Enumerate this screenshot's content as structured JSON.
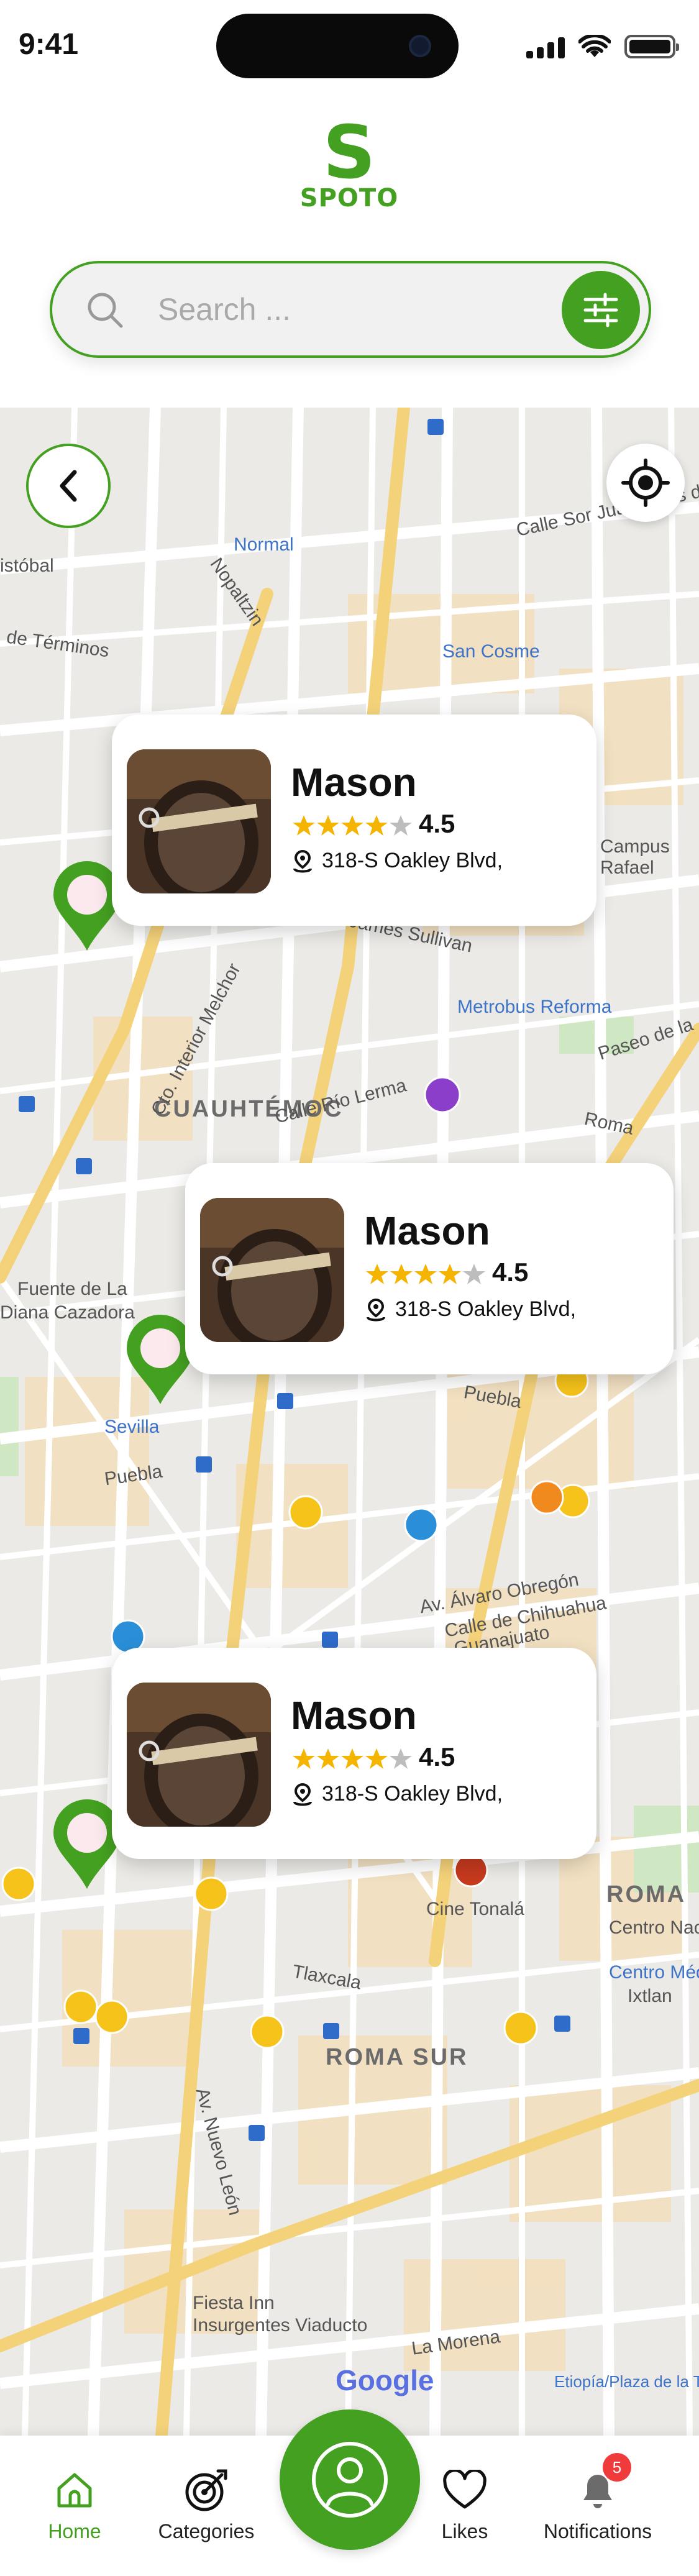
{
  "status_bar": {
    "time": "9:41"
  },
  "brand": {
    "mark": "S",
    "name": "SPOTO",
    "color": "#43a020"
  },
  "search": {
    "placeholder": "Search ...",
    "value": ""
  },
  "map": {
    "labels": {
      "normal": "Normal",
      "san_cosme": "San Cosme",
      "metrobus": "Metrobus Reforma",
      "cuauhtemoc": "CUAUHTÉMOC",
      "roma_sur": "ROMA SUR",
      "roma": "ROMA",
      "cine": "Cine Tonalá",
      "fiesta": "Fiesta Inn",
      "insurgentes": "Insurgentes Viaducto",
      "la_morena": "La Morena",
      "fuente": "Fuente de La",
      "diana": "Diana Cazadora",
      "sevilla": "Sevilla",
      "campus": "Campus",
      "rafael": "Rafael",
      "calle_sor": "Calle Sor Juana Inés de",
      "sullivan": "James Sullivan",
      "rio_lerma": "Calle Río Lerma",
      "puebla": "Puebla",
      "alvaro": "Av. Álvaro Obregón",
      "chihuahua": "Calle de Chihuahua",
      "guanajuato": "Guanajuato",
      "tlaxcala": "Tlaxcala",
      "centro_medico": "Centro Médico",
      "centro_nacional": "Centro Nacional",
      "ixtlan": "Ixtlan",
      "etiopia": "Etiopía/Plaza de la Transparencia",
      "nopaltzin": "Nopaltzin",
      "terminos": "de Términos",
      "istobal": "istóbal",
      "circuito": "Cto. Interior Melchor",
      "av_nuevo_leon": "Av. Nuevo León",
      "paseo": "Paseo de la",
      "roma_ave": "Roma"
    },
    "google": "Google"
  },
  "places": [
    {
      "name": "Mason",
      "rating": "4.5",
      "stars": 4,
      "address": "318-S Oakley Blvd,"
    },
    {
      "name": "Mason",
      "rating": "4.5",
      "stars": 4,
      "address": "318-S Oakley Blvd,"
    },
    {
      "name": "Mason",
      "rating": "4.5",
      "stars": 4,
      "address": "318-S Oakley Blvd,"
    }
  ],
  "bottom_nav": {
    "home": "Home",
    "categories": "Categories",
    "likes": "Likes",
    "notifications": "Notifications",
    "notification_count": "5"
  },
  "colors": {
    "accent": "#43a020",
    "badge": "#ef3b3b",
    "star": "#f5b400"
  }
}
